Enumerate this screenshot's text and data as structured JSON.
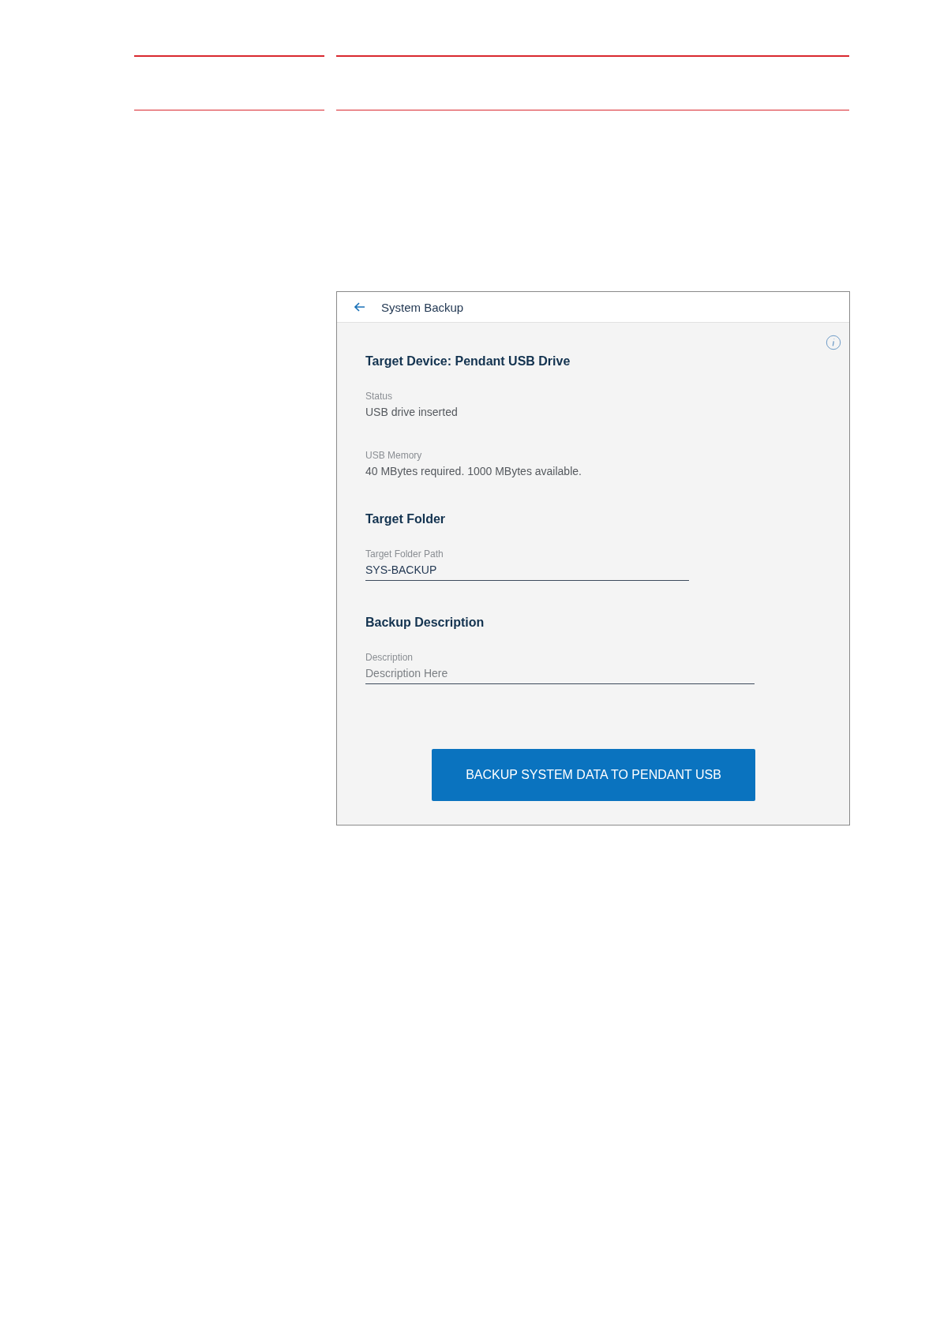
{
  "window": {
    "title": "System Backup"
  },
  "target_device": {
    "heading": "Target Device: Pendant USB Drive",
    "info": [
      {
        "label": "Status",
        "value": "USB drive inserted"
      },
      {
        "label": "USB Memory",
        "value": "40 MBytes required. 1000 MBytes available."
      }
    ]
  },
  "target_folder": {
    "heading": "Target Folder",
    "field": {
      "label": "Target Folder Path",
      "value": "SYS-BACKUP"
    }
  },
  "backup_description": {
    "heading": "Backup Description",
    "field": {
      "label": "Description",
      "placeholder": "Description Here"
    }
  },
  "buttons": [
    "BACKUP SYSTEM DATA TO PENDANT USB"
  ]
}
